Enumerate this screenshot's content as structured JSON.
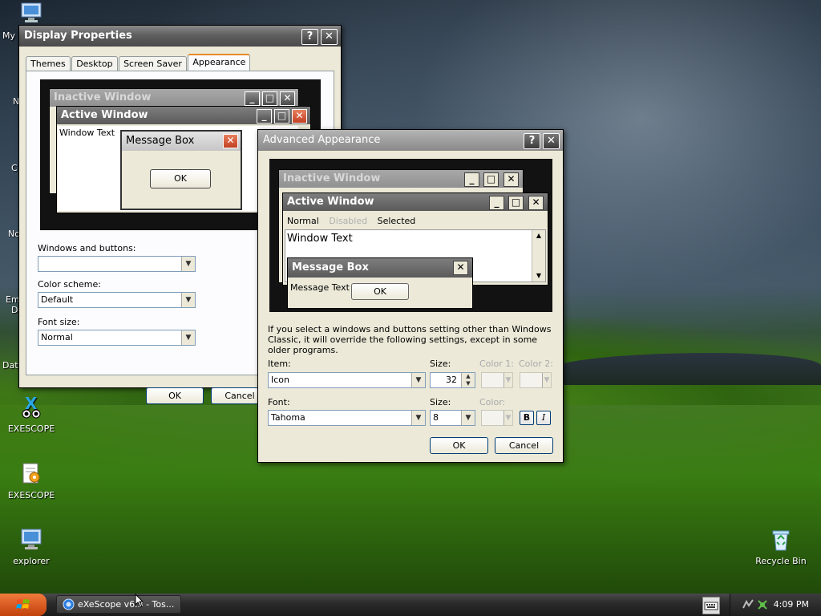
{
  "desktop": {
    "icons": [
      {
        "label": "EXESCOPE"
      },
      {
        "label": "EXESCOPE"
      },
      {
        "label": "explorer"
      },
      {
        "label": "Recycle Bin"
      }
    ],
    "edge_labels": [
      "My",
      "N",
      "C",
      "No",
      "Em",
      "D",
      "Dat"
    ]
  },
  "display_properties": {
    "title": "Display Properties",
    "help": "?",
    "close": "✕",
    "tabs": [
      "Themes",
      "Desktop",
      "Screen Saver",
      "Appearance"
    ],
    "preview": {
      "inactive_title": "Inactive Window",
      "active_title": "Active Window",
      "window_text": "Window Text",
      "message_box_title": "Message Box",
      "ok": "OK"
    },
    "windows_buttons_label": "Windows and buttons:",
    "windows_buttons_value": "",
    "color_scheme_label": "Color scheme:",
    "color_scheme_value": "Default",
    "font_size_label": "Font size:",
    "font_size_value": "Normal",
    "ok": "OK",
    "cancel": "Cancel"
  },
  "advanced_appearance": {
    "title": "Advanced Appearance",
    "help": "?",
    "close": "✕",
    "preview": {
      "inactive_title": "Inactive Window",
      "active_title": "Active Window",
      "menu_normal": "Normal",
      "menu_disabled": "Disabled",
      "menu_selected": "Selected",
      "window_text": "Window Text",
      "message_box_title": "Message Box",
      "message_text": "Message Text",
      "ok": "OK"
    },
    "info": "If you select a windows and buttons setting other than Windows Classic, it will override the following settings, except in some older programs.",
    "item_label": "Item:",
    "item_value": "Icon",
    "size_label": "Size:",
    "size_value": "32",
    "color1_label": "Color 1:",
    "color2_label": "Color 2:",
    "font_label": "Font:",
    "font_value": "Tahoma",
    "font_size_label": "Size:",
    "font_size_value": "8",
    "font_color_label": "Color:",
    "bold": "B",
    "italic": "I",
    "ok": "OK",
    "cancel": "Cancel"
  },
  "taskbar": {
    "task_label": "eXeScope v6.3 - Tos...",
    "clock": "4:09 PM"
  }
}
